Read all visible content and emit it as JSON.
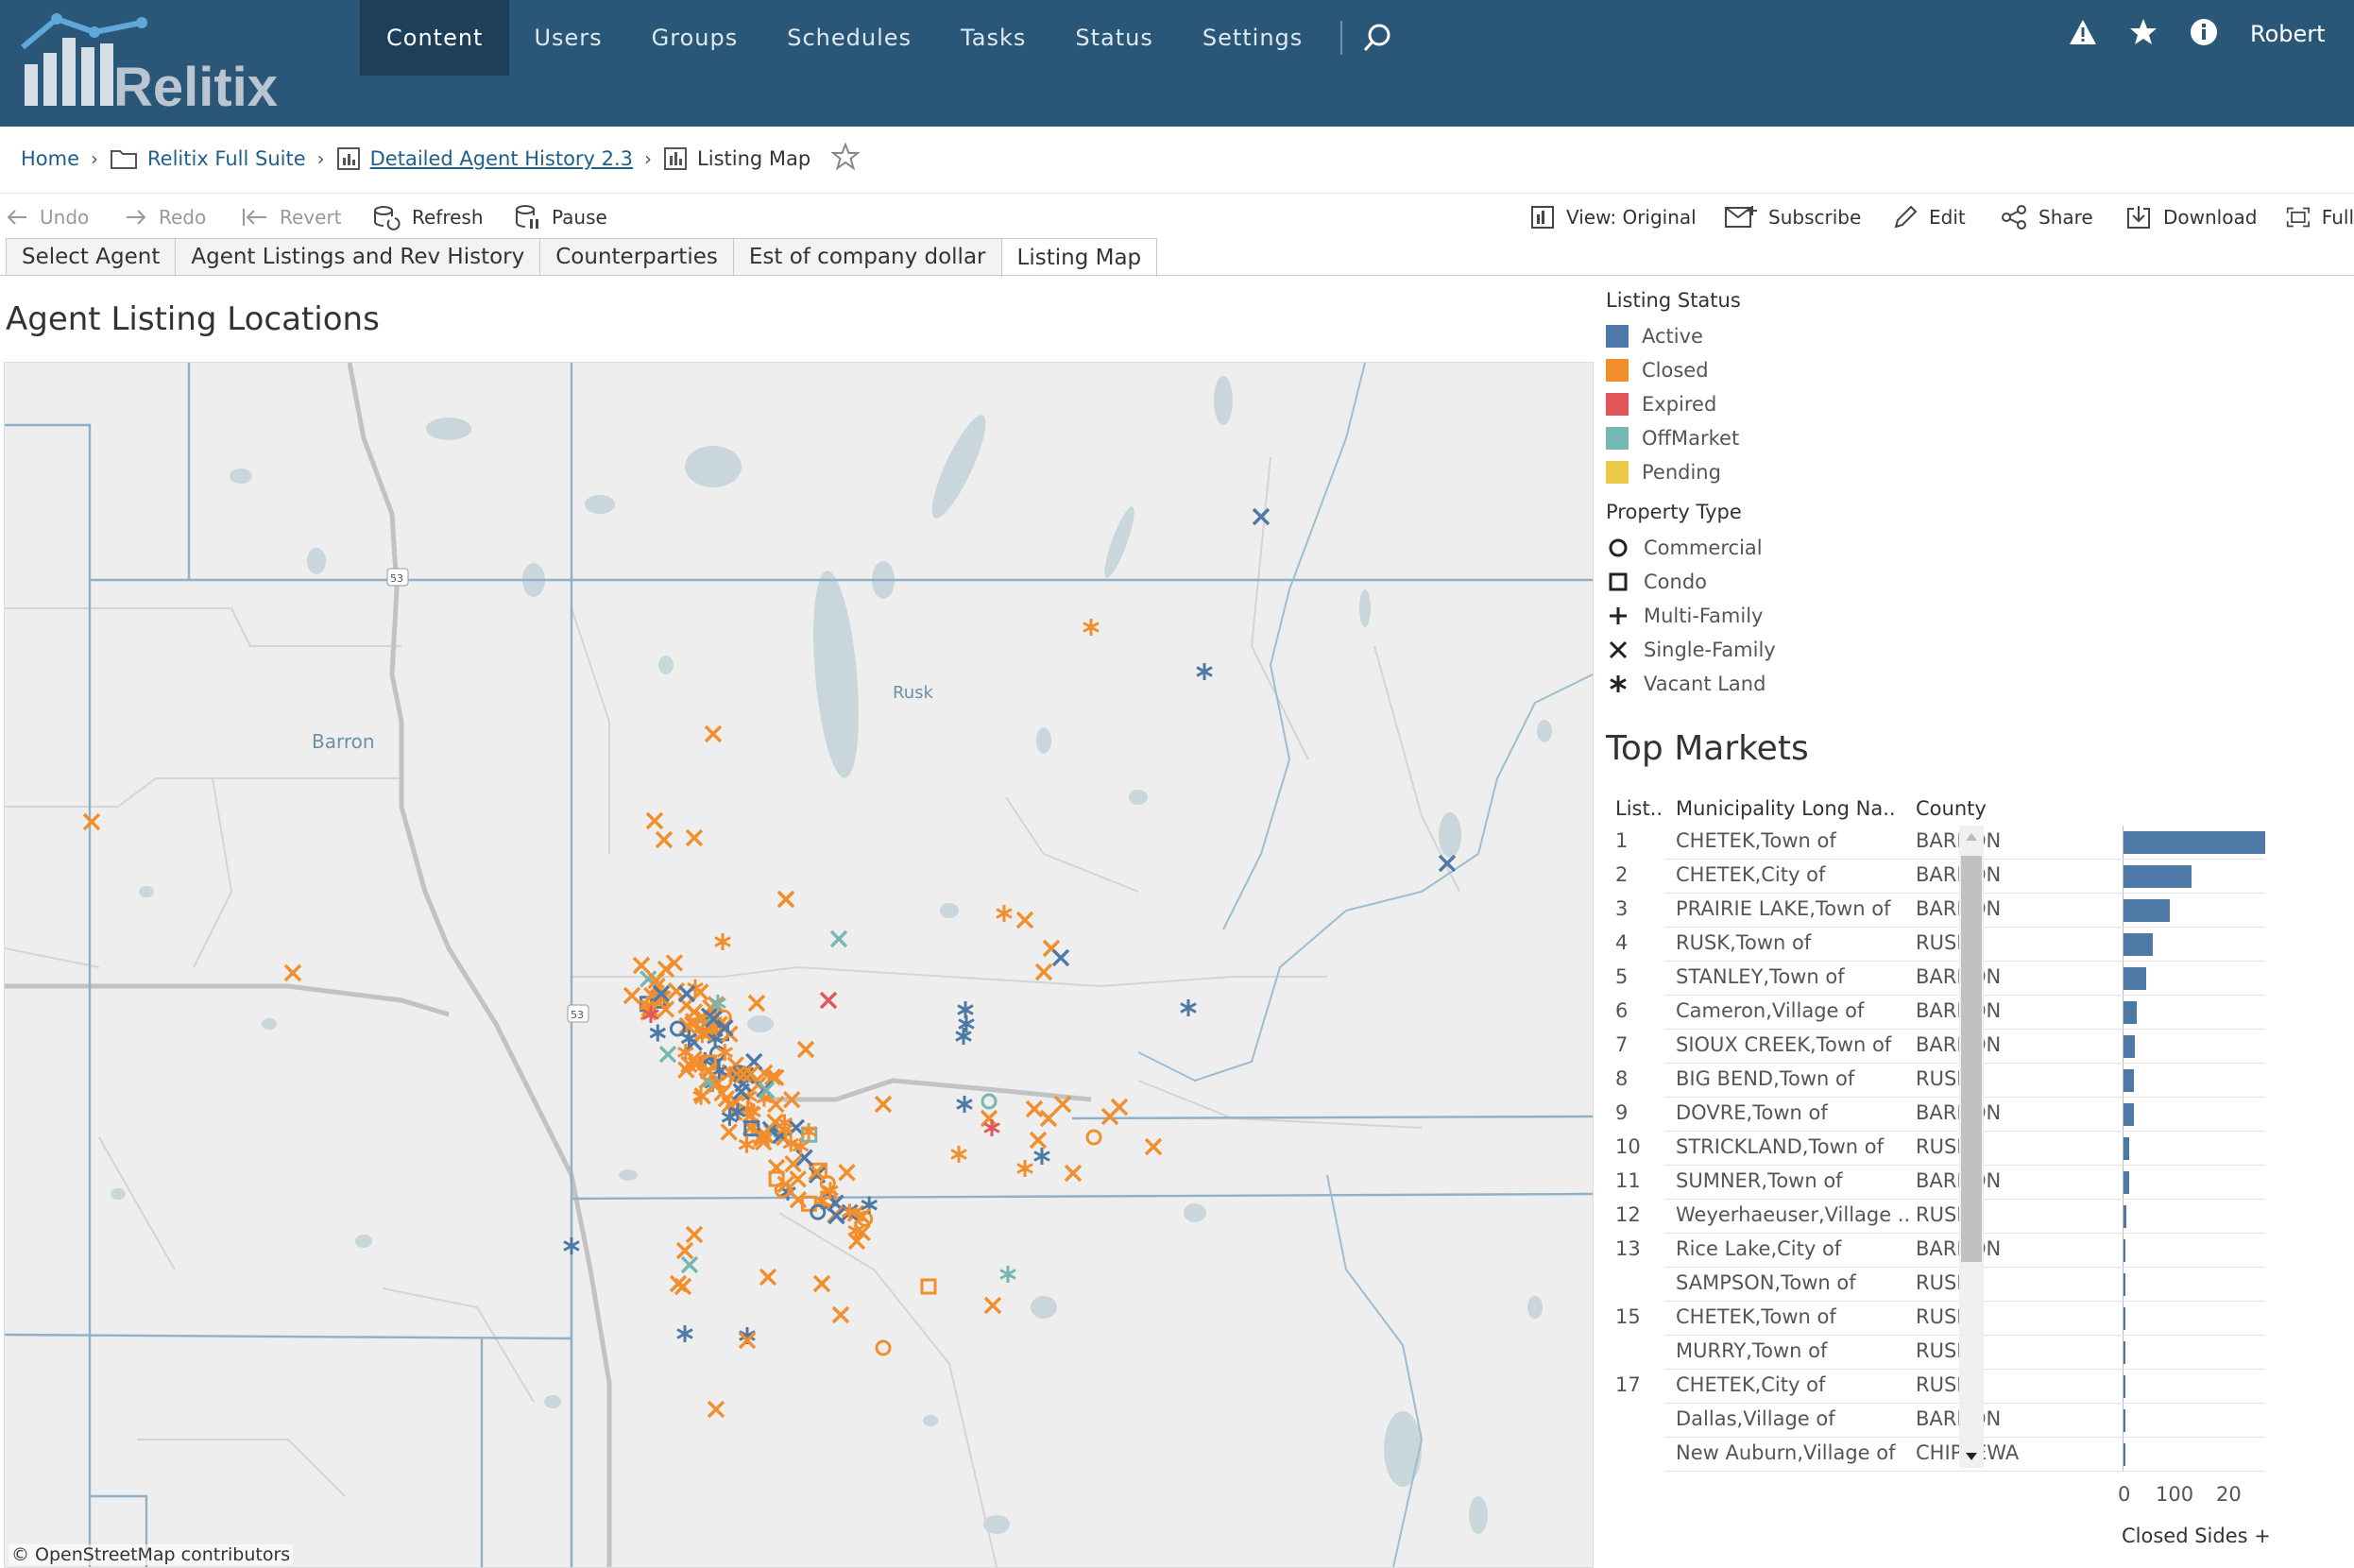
{
  "topbar": {
    "logo_text": "Relitix",
    "nav": [
      {
        "label": "Content",
        "active": true
      },
      {
        "label": "Users",
        "active": false
      },
      {
        "label": "Groups",
        "active": false
      },
      {
        "label": "Schedules",
        "active": false
      },
      {
        "label": "Tasks",
        "active": false
      },
      {
        "label": "Status",
        "active": false
      },
      {
        "label": "Settings",
        "active": false
      }
    ],
    "user_name": "Robert"
  },
  "breadcrumb": {
    "home": "Home",
    "project": "Relitix Full Suite",
    "workbook": "Detailed Agent History 2.3",
    "view": "Listing Map"
  },
  "toolbar": {
    "undo": "Undo",
    "redo": "Redo",
    "revert": "Revert",
    "refresh": "Refresh",
    "pause": "Pause",
    "view_original": "View: Original",
    "subscribe": "Subscribe",
    "edit": "Edit",
    "share": "Share",
    "download": "Download",
    "full": "Full"
  },
  "tabs": [
    {
      "label": "Select Agent",
      "active": false
    },
    {
      "label": "Agent Listings and Rev History",
      "active": false
    },
    {
      "label": "Counterparties",
      "active": false
    },
    {
      "label": "Est of company dollar",
      "active": false
    },
    {
      "label": "Listing Map",
      "active": true
    }
  ],
  "map": {
    "title": "Agent Listing Locations",
    "places": [
      {
        "label": "Barron"
      },
      {
        "label": "Rusk"
      }
    ],
    "highways": [
      {
        "label": "53"
      },
      {
        "label": "53"
      }
    ],
    "attribution": "© OpenStreetMap contributors"
  },
  "legend": {
    "status_title": "Listing Status",
    "status": [
      {
        "label": "Active",
        "color": "#4e79a7"
      },
      {
        "label": "Closed",
        "color": "#f28e2b"
      },
      {
        "label": "Expired",
        "color": "#e15759"
      },
      {
        "label": "OffMarket",
        "color": "#76b7b2"
      },
      {
        "label": "Pending",
        "color": "#edc948"
      }
    ],
    "type_title": "Property Type",
    "types": [
      {
        "label": "Commercial",
        "icon": "circle-icon"
      },
      {
        "label": "Condo",
        "icon": "square-icon"
      },
      {
        "label": "Multi-Family",
        "icon": "plus-icon"
      },
      {
        "label": "Single-Family",
        "icon": "x-icon"
      },
      {
        "label": "Vacant Land",
        "icon": "asterisk-icon"
      }
    ]
  },
  "top_markets": {
    "title": "Top Markets",
    "headers": {
      "rank": "List..",
      "municipality": "Municipality Long Na..",
      "county": "County"
    },
    "rows": [
      {
        "rank": "1",
        "municipality": "CHETEK,Town of",
        "county": "BARRON",
        "value": 205
      },
      {
        "rank": "2",
        "municipality": "CHETEK,City of",
        "county": "BARRON",
        "value": 98
      },
      {
        "rank": "3",
        "municipality": "PRAIRIE LAKE,Town of",
        "county": "BARRON",
        "value": 67
      },
      {
        "rank": "4",
        "municipality": "RUSK,Town of",
        "county": "RUSK",
        "value": 43
      },
      {
        "rank": "5",
        "municipality": "STANLEY,Town of",
        "county": "BARRON",
        "value": 33
      },
      {
        "rank": "6",
        "municipality": "Cameron,Village of",
        "county": "BARRON",
        "value": 19
      },
      {
        "rank": "7",
        "municipality": "SIOUX CREEK,Town of",
        "county": "BARRON",
        "value": 17
      },
      {
        "rank": "8",
        "municipality": "BIG BEND,Town of",
        "county": "RUSK",
        "value": 15
      },
      {
        "rank": "9",
        "municipality": "DOVRE,Town of",
        "county": "BARRON",
        "value": 15
      },
      {
        "rank": "10",
        "municipality": "STRICKLAND,Town of",
        "county": "RUSK",
        "value": 8
      },
      {
        "rank": "11",
        "municipality": "SUMNER,Town of",
        "county": "BARRON",
        "value": 8
      },
      {
        "rank": "12",
        "municipality": "Weyerhaeuser,Village ..",
        "county": "RUSK",
        "value": 4
      },
      {
        "rank": "13",
        "municipality": "Rice Lake,City of",
        "county": "BARRON",
        "value": 3
      },
      {
        "rank": "",
        "municipality": "SAMPSON,Town of",
        "county": "RUSK",
        "value": 3
      },
      {
        "rank": "15",
        "municipality": "CHETEK,Town of",
        "county": "RUSK",
        "value": 2
      },
      {
        "rank": "",
        "municipality": "MURRY,Town of",
        "county": "RUSK",
        "value": 2
      },
      {
        "rank": "17",
        "municipality": "CHETEK,City of",
        "county": "RUSK",
        "value": 1
      },
      {
        "rank": "",
        "municipality": "Dallas,Village of",
        "county": "BARRON",
        "value": 1
      },
      {
        "rank": "",
        "municipality": "New Auburn,Village of",
        "county": "CHIPPEWA",
        "value": 1
      }
    ],
    "axis_ticks": [
      "0",
      "100",
      "20"
    ],
    "axis_title": "Closed Sides +"
  }
}
